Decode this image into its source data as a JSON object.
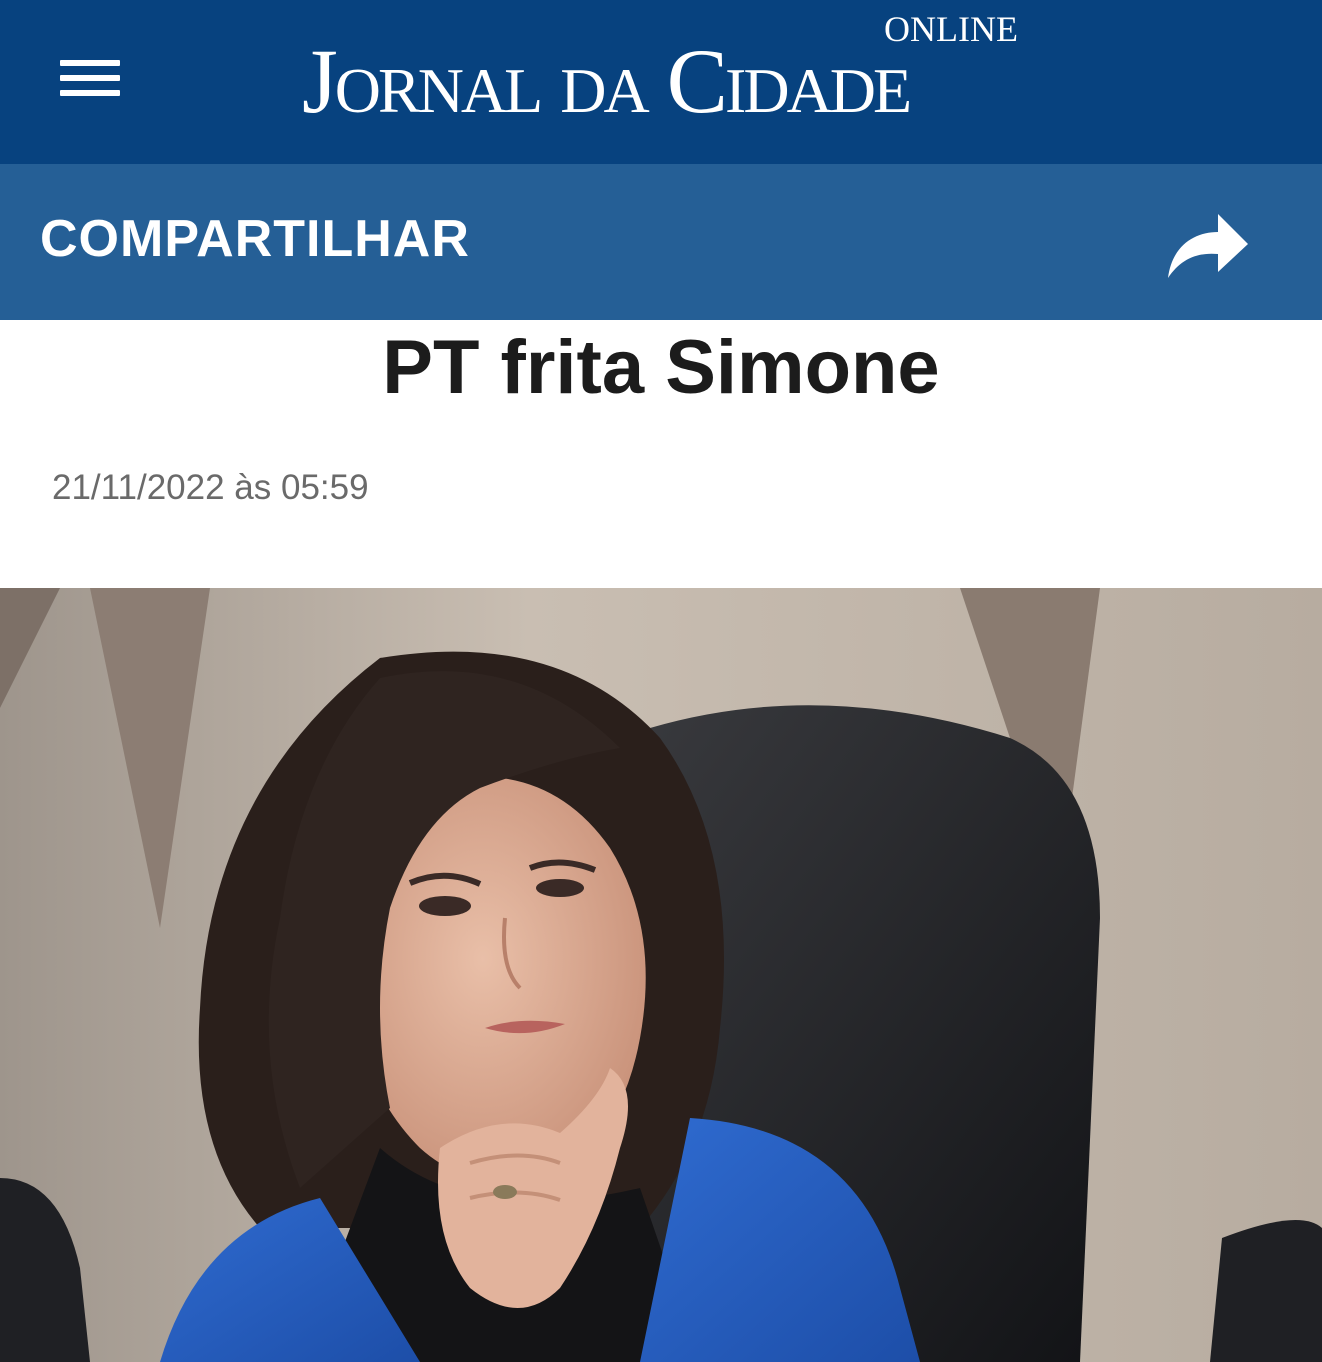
{
  "header": {
    "logo_online": "ONLINE",
    "logo_title": "Jornal da Cidade",
    "background_color": "#07427f",
    "menu_icon": "hamburger-menu-icon"
  },
  "share_bar": {
    "label": "COMPARTILHAR",
    "icon": "share-arrow-icon",
    "background_color": "#255f96"
  },
  "article": {
    "title": "PT frita Simone",
    "date": "21/11/2022 às 05:59"
  }
}
